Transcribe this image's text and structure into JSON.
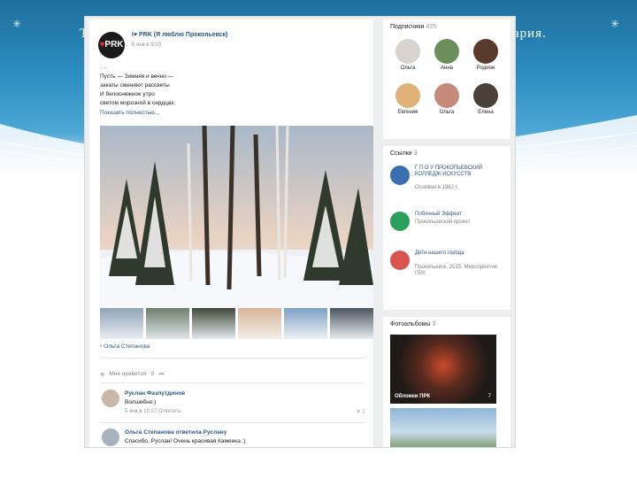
{
  "slide": {
    "heading_left": "Т",
    "heading_right": "ария."
  },
  "post": {
    "group_name": "I♥ PRK (Я люблю Прокопьевск)",
    "logo_letters": "PRK",
    "date": "5 янв в 9:03",
    "dots": "...",
    "poem_lines": [
      "Пусть — Зимняя и вечно —",
      "закаты сменяют рассветы",
      "И белоснежное утро",
      "светом морозной в сердцах."
    ],
    "show_full": "Показать полностью...",
    "attachment_author": "Ольга Степанова",
    "likes_label": "Мне нравится",
    "likes_count": "9",
    "comments": [
      {
        "name": "Руслан Фазлутдинов",
        "text": "Волшебно:)",
        "meta": "5 янв в 10:27  Ответить",
        "like": "♥ 2"
      },
      {
        "name": "Ольга Степанова ответила Руслану",
        "text": "Спасибо, Руслан! Очень красивая Каменка :)",
        "meta": "",
        "like": ""
      }
    ]
  },
  "side": {
    "subscribers": {
      "title": "Подписчики",
      "count": "425",
      "people": [
        "Ольга",
        "Анна",
        "Родион",
        "Евгения",
        "Ольга",
        "Елена"
      ]
    },
    "links": {
      "title": "Ссылки",
      "count": "3",
      "items": [
        {
          "name": "Г П О У ПРОКОПЬЕВСКИЙ КОЛЛЕДЖ ИСКУССТВ",
          "desc": "Основан в 1962 г."
        },
        {
          "name": "Побочный Эффект",
          "desc": "Прокопьевский проект"
        },
        {
          "name": "Дети нашего города",
          "desc": "Прокопьевск, 2015. Мероприятие ПРК"
        }
      ]
    },
    "albums": {
      "title": "Фотоальбомы",
      "count": "3",
      "items": [
        {
          "caption": "Обложки ПРК",
          "count": "7"
        }
      ]
    }
  },
  "colors": {
    "accent_link": "#2a5885",
    "vk_bg": "#edeef0",
    "slide_blue": "#2b8cc0"
  }
}
